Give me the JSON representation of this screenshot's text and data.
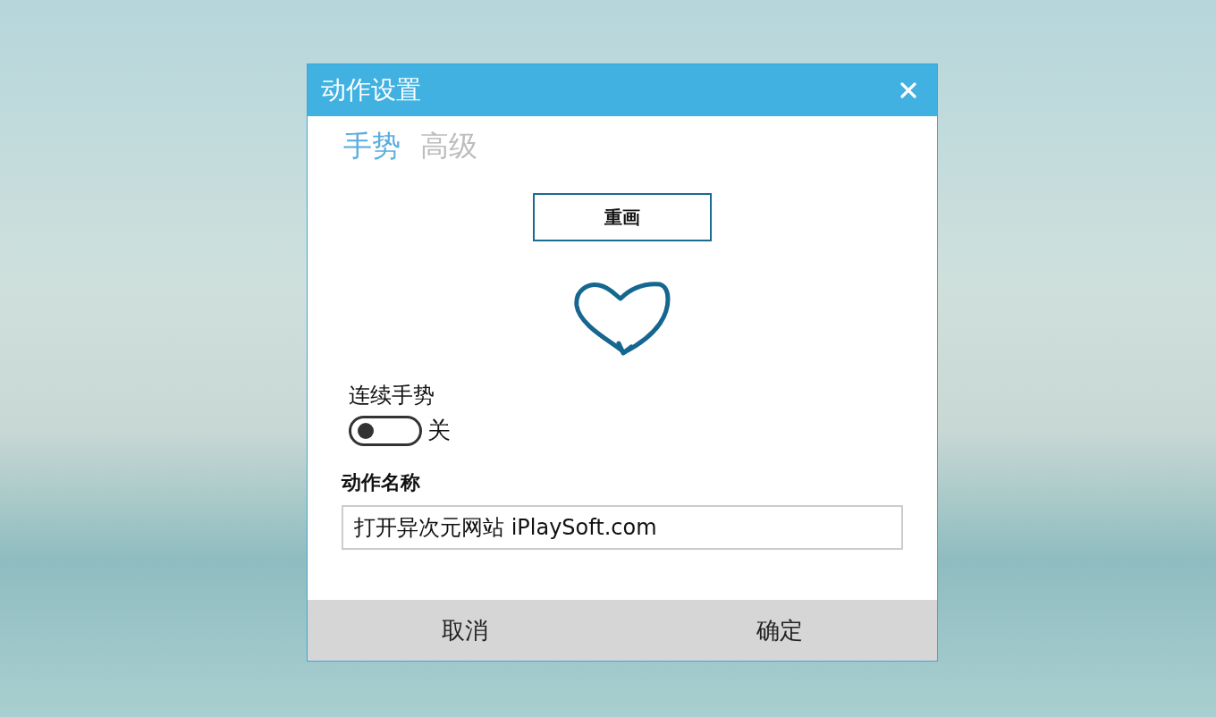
{
  "window": {
    "title": "动作设置"
  },
  "tabs": [
    {
      "label": "手势",
      "selected": true
    },
    {
      "label": "高级",
      "selected": false
    }
  ],
  "redraw_button": "重画",
  "continuous_gesture": {
    "label": "连续手势",
    "on": false,
    "state_text": "关"
  },
  "action_name": {
    "label": "动作名称",
    "value": "打开异次元网站 iPlaySoft.com"
  },
  "buttons": [
    "取消",
    "确定"
  ]
}
